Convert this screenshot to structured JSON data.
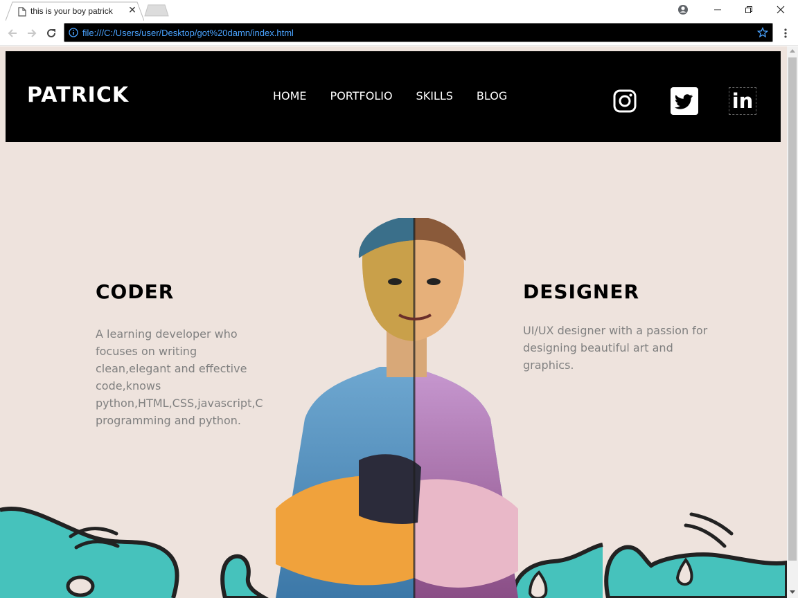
{
  "browser": {
    "tab_title": "this is your boy patrick",
    "url": "file:///C:/Users/user/Desktop/got%20damn/index.html"
  },
  "site": {
    "brand": "PATRICK",
    "nav": [
      "HOME",
      "PORTFOLIO",
      "SKILLS",
      "BLOG"
    ],
    "social": [
      "instagram-icon",
      "twitter-icon",
      "linkedin-icon"
    ],
    "linkedin_text": "in",
    "coder": {
      "title": "CODER",
      "text": "A learning developer who focuses on writing clean,elegant and effective code,knows python,HTML,CSS,javascript,C programming and python."
    },
    "designer": {
      "title": "DESIGNER",
      "text": "UI/UX designer with a passion for designing beautiful art and graphics."
    }
  },
  "colors": {
    "page_bg": "#eee3dd",
    "header_bg": "#000000",
    "wave": "#3ec8bf",
    "url_text": "#4aa3ff"
  }
}
